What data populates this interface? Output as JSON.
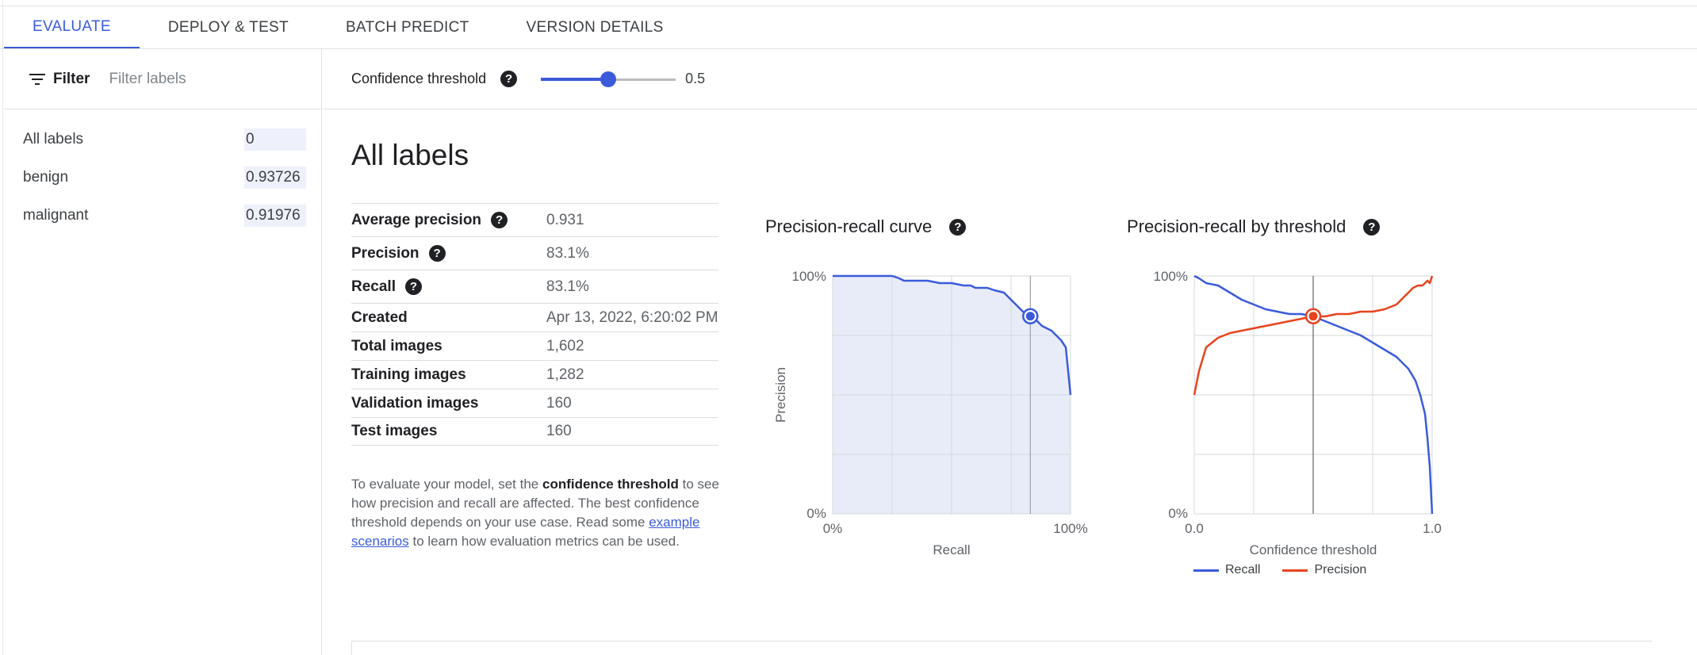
{
  "tabs": [
    {
      "label": "EVALUATE",
      "active": true
    },
    {
      "label": "DEPLOY & TEST",
      "active": false
    },
    {
      "label": "BATCH PREDICT",
      "active": false
    },
    {
      "label": "VERSION DETAILS",
      "active": false
    }
  ],
  "filter": {
    "label": "Filter",
    "placeholder": "Filter labels"
  },
  "labels": [
    {
      "name": "All labels",
      "score": "0"
    },
    {
      "name": "benign",
      "score": "0.93726"
    },
    {
      "name": "malignant",
      "score": "0.91976"
    }
  ],
  "threshold": {
    "label": "Confidence threshold",
    "value": 0.5,
    "value_text": "0.5"
  },
  "page_title": "All labels",
  "metrics": [
    {
      "name": "Average precision",
      "value": "0.931",
      "help": true
    },
    {
      "name": "Precision",
      "value": "83.1%",
      "help": true
    },
    {
      "name": "Recall",
      "value": "83.1%",
      "help": true
    },
    {
      "name": "Created",
      "value": "Apr 13, 2022, 6:20:02 PM",
      "help": false
    },
    {
      "name": "Total images",
      "value": "1,602",
      "help": false
    },
    {
      "name": "Training images",
      "value": "1,282",
      "help": false
    },
    {
      "name": "Validation images",
      "value": "160",
      "help": false
    },
    {
      "name": "Test images",
      "value": "160",
      "help": false
    }
  ],
  "description": {
    "part1": "To evaluate your model, set the ",
    "bold": "confidence threshold",
    "part2": " to see how precision and recall are affected. The best confidence threshold depends on your use case. Read some ",
    "link": "example scenarios",
    "part3": " to learn how evaluation metrics can be used."
  },
  "help_glyph": "?",
  "colors": {
    "accent": "#3b5bdb",
    "recall": "#3b5bdb",
    "precision": "#e8431e",
    "fill": "#e8ecf8"
  },
  "chart_data": [
    {
      "type": "area",
      "title": "Precision-recall curve",
      "xlabel": "Recall",
      "ylabel": "Precision",
      "xlim": [
        0,
        1
      ],
      "ylim": [
        0,
        1
      ],
      "x_ticks": [
        "0%",
        "100%"
      ],
      "y_ticks": [
        "0%",
        "100%"
      ],
      "grid": true,
      "series": [
        {
          "x": [
            0,
            0.05,
            0.1,
            0.15,
            0.2,
            0.25,
            0.28,
            0.3,
            0.35,
            0.4,
            0.45,
            0.5,
            0.55,
            0.58,
            0.6,
            0.65,
            0.68,
            0.72,
            0.75,
            0.78,
            0.8,
            0.82,
            0.84,
            0.86,
            0.88,
            0.9,
            0.92,
            0.94,
            0.96,
            0.98,
            1.0
          ],
          "y": [
            1.0,
            1.0,
            1.0,
            1.0,
            1.0,
            1.0,
            0.99,
            0.98,
            0.98,
            0.98,
            0.97,
            0.97,
            0.96,
            0.96,
            0.95,
            0.95,
            0.94,
            0.93,
            0.9,
            0.87,
            0.85,
            0.84,
            0.83,
            0.81,
            0.79,
            0.78,
            0.77,
            0.75,
            0.73,
            0.7,
            0.5
          ]
        }
      ],
      "marker": {
        "x": 0.831,
        "y": 0.831
      }
    },
    {
      "type": "line",
      "title": "Precision-recall by threshold",
      "xlabel": "Confidence threshold",
      "xlim": [
        0,
        1
      ],
      "ylim": [
        0,
        1
      ],
      "x_ticks": [
        "0.0",
        "1.0"
      ],
      "y_ticks": [
        "0%",
        "100%"
      ],
      "grid": true,
      "legend": "bottom",
      "series": [
        {
          "name": "Recall",
          "x": [
            0,
            0.02,
            0.05,
            0.1,
            0.15,
            0.2,
            0.25,
            0.3,
            0.35,
            0.4,
            0.45,
            0.5,
            0.55,
            0.6,
            0.65,
            0.7,
            0.75,
            0.8,
            0.85,
            0.88,
            0.9,
            0.93,
            0.95,
            0.97,
            0.98,
            0.99,
            1.0
          ],
          "y": [
            1.0,
            0.99,
            0.97,
            0.96,
            0.93,
            0.9,
            0.88,
            0.86,
            0.85,
            0.84,
            0.84,
            0.83,
            0.81,
            0.79,
            0.77,
            0.75,
            0.72,
            0.69,
            0.66,
            0.63,
            0.61,
            0.56,
            0.5,
            0.42,
            0.32,
            0.2,
            0.0
          ]
        },
        {
          "name": "Precision",
          "x": [
            0,
            0.02,
            0.05,
            0.1,
            0.15,
            0.2,
            0.25,
            0.3,
            0.35,
            0.4,
            0.45,
            0.5,
            0.55,
            0.6,
            0.65,
            0.7,
            0.75,
            0.8,
            0.85,
            0.88,
            0.9,
            0.92,
            0.94,
            0.96,
            0.98,
            0.99,
            1.0
          ],
          "y": [
            0.5,
            0.6,
            0.7,
            0.74,
            0.76,
            0.77,
            0.78,
            0.79,
            0.8,
            0.81,
            0.82,
            0.83,
            0.83,
            0.84,
            0.84,
            0.85,
            0.85,
            0.86,
            0.88,
            0.91,
            0.93,
            0.95,
            0.96,
            0.96,
            0.98,
            0.97,
            1.0
          ]
        }
      ],
      "marker": {
        "x": 0.5,
        "y": 0.831
      }
    }
  ]
}
